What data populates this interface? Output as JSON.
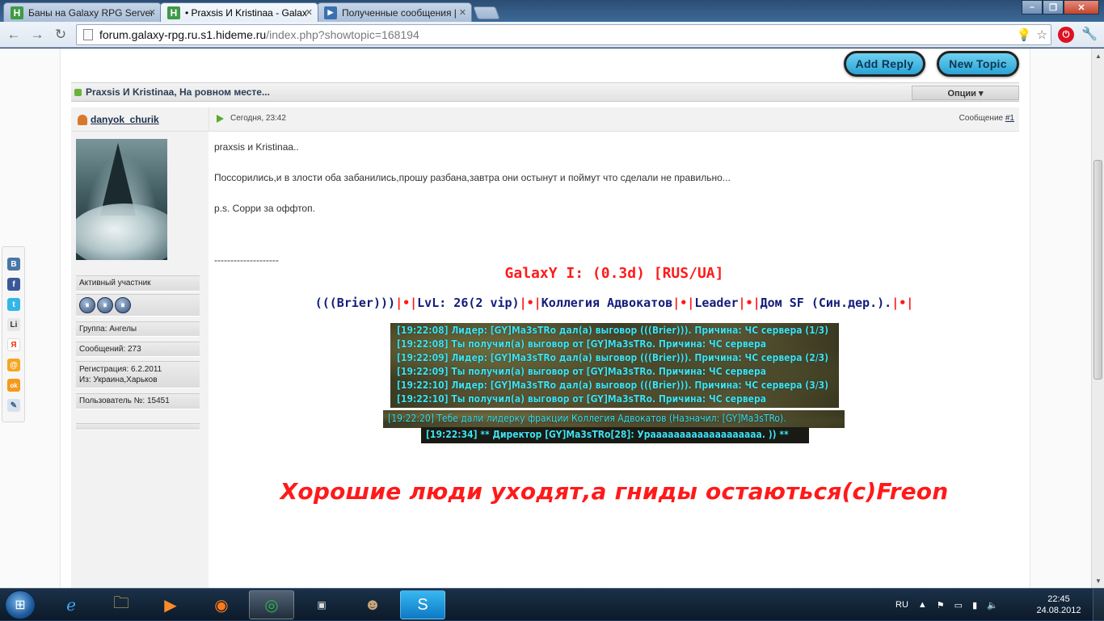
{
  "browser": {
    "tabs": [
      {
        "title": "Баны на Galaxy RPG Server",
        "favicon": "H"
      },
      {
        "title": "• Praxsis И Kristinaa - Galax",
        "favicon": "H"
      },
      {
        "title": "Полученные сообщения |",
        "favicon": "▶"
      }
    ],
    "url_host": "forum.galaxy-rpg.ru.s1.hideme.ru",
    "url_path": "/index.php?showtopic=168194"
  },
  "forum": {
    "add_reply": "Add Reply",
    "new_topic": "New Topic",
    "topic_title": "Praxsis И Kristinaa, На ровном месте...",
    "options_label": "Опции ▾",
    "post": {
      "author": "danyok_churik",
      "date": "Сегодня, 23:42",
      "number_prefix": "Сообщение",
      "number_link": "#1",
      "body_line1": "praxsis и Kristinaa..",
      "body_line2": "Поссорились,и в злости оба забанились,прошу разбана,завтра они остынут и поймут что сделали не правильно...",
      "body_line3": "p.s. Сорри за оффтоп.",
      "separator": "--------------------"
    },
    "user_info": {
      "rank": "Активный участник",
      "pips": [
        "⏸",
        "⏸",
        "⏸"
      ],
      "group": "Группа: Ангелы",
      "posts": "Сообщений: 273",
      "registered": "Регистрация: 6.2.2011",
      "location": "Из: Украина,Харьков",
      "user_number": "Пользователь №: 15451"
    },
    "signature": {
      "server": "GalaxY I: (0.3d) [RUS/UA]",
      "stats_name": "(((Brier)))",
      "sep1": "|•|",
      "stats_lvl": "LvL: 26(2 vip)",
      "sep2": "|•|",
      "stats_faction": "Коллегия Адвокатов",
      "sep3": "|•|",
      "stats_rank": "Leader",
      "sep4": "|•|",
      "stats_house": "Дом SF (Син.дер.).",
      "sep5": "|•|",
      "chat_lines": [
        "[19:22:08] Лидер: [GY]Ma3sTRo дал(а) выговор (((Brier))). Причина: ЧС сервера (1/3)",
        "[19:22:08] Ты получил(а) выговор от [GY]Ma3sTRo. Причина: ЧС сервера",
        "[19:22:09] Лидер: [GY]Ma3sTRo дал(а) выговор (((Brier))). Причина: ЧС сервера (2/3)",
        "[19:22:09] Ты получил(а) выговор от [GY]Ma3sTRo. Причина: ЧС сервера",
        "[19:22:10] Лидер: [GY]Ma3sTRo дал(а) выговор (((Brier))). Причина: ЧС сервера (3/3)",
        "[19:22:10] Ты получил(а) выговор от [GY]Ma3sTRo. Причина: ЧС сервера"
      ],
      "chat_line7": "[19:22:20] Тебе дали лидерку фракции Коллегия Адвокатов (Назначил: [GY]Ma3sTRo).",
      "chat_line8": "[19:22:34] ** Директор [GY]Ma3sTRo[28]: Урааааааааааааааааааа. )) **",
      "quote": "Хорошие люди уходят,а гниды остаються(с)Freon"
    }
  },
  "share_icons": [
    "B",
    "f",
    "t",
    "Li",
    "Я",
    "@",
    "ok",
    "✎"
  ],
  "taskbar": {
    "lang": "RU",
    "time": "22:45",
    "date": "24.08.2012"
  },
  "colors": {
    "signature_red": "#ff1a1a",
    "signature_navy": "#121c7a",
    "chat_cyan": "#3fe3f2",
    "button_blue": "#2aa3d6"
  }
}
